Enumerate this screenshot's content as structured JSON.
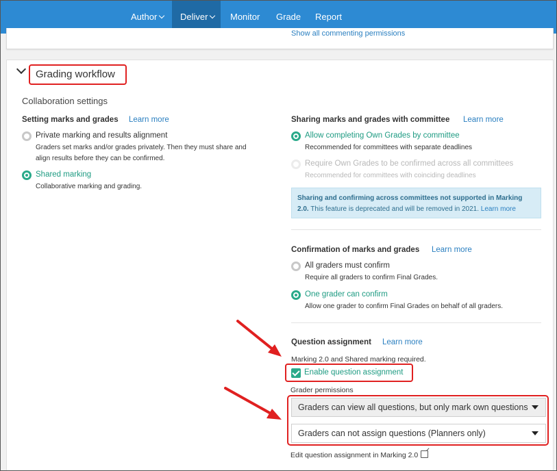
{
  "nav": {
    "items": [
      {
        "label": "Author",
        "has_caret": true
      },
      {
        "label": "Deliver",
        "has_caret": true,
        "active": true
      },
      {
        "label": "Monitor"
      },
      {
        "label": "Grade"
      },
      {
        "label": "Report"
      }
    ]
  },
  "previous_card": {
    "link": "Show all commenting permissions"
  },
  "section": {
    "title": "Grading workflow",
    "subtitle": "Collaboration settings"
  },
  "setting_marks": {
    "heading": "Setting marks and grades",
    "learn_more": "Learn more",
    "options": [
      {
        "label": "Private marking and results alignment",
        "desc1": "Graders set marks and/or grades privately. Then they must share and",
        "desc2": "align results before they can be confirmed.",
        "selected": false
      },
      {
        "label": "Shared marking",
        "desc1": "Collaborative marking and grading.",
        "selected": true
      }
    ]
  },
  "sharing": {
    "heading": "Sharing marks and grades with committee",
    "learn_more": "Learn more",
    "options": [
      {
        "label": "Allow completing Own Grades by committee",
        "desc": "Recommended for committees with separate deadlines",
        "selected": true
      },
      {
        "label": "Require Own Grades to be confirmed across all committees",
        "desc": "Recommended for committees with coinciding deadlines",
        "disabled": true
      }
    ],
    "info_bold": "Sharing and confirming across committees not supported in Marking 2.0.",
    "info_text": "This feature is deprecated and will be removed in 2021.",
    "info_link": "Learn more"
  },
  "confirmation": {
    "heading": "Confirmation of marks and grades",
    "learn_more": "Learn more",
    "options": [
      {
        "label": "All graders must confirm",
        "desc": "Require all graders to confirm Final Grades.",
        "selected": false
      },
      {
        "label": "One grader can confirm",
        "desc": "Allow one grader to confirm Final Grades on behalf of all graders.",
        "selected": true
      }
    ]
  },
  "question_assignment": {
    "heading": "Question assignment",
    "learn_more": "Learn more",
    "note": "Marking 2.0 and Shared marking required.",
    "checkbox_label": "Enable question assignment",
    "checked": true,
    "permissions_label": "Grader permissions",
    "dropdown1": "Graders can view all questions, but only mark own questions",
    "dropdown2": "Graders can not assign questions (Planners only)",
    "edit_link": "Edit question assignment in Marking 2.0"
  },
  "colors": {
    "nav_bg": "#2d8ad3",
    "nav_active": "#1f6aa5",
    "accent_green": "#2aaa8a",
    "annotation_red": "#e02020"
  }
}
